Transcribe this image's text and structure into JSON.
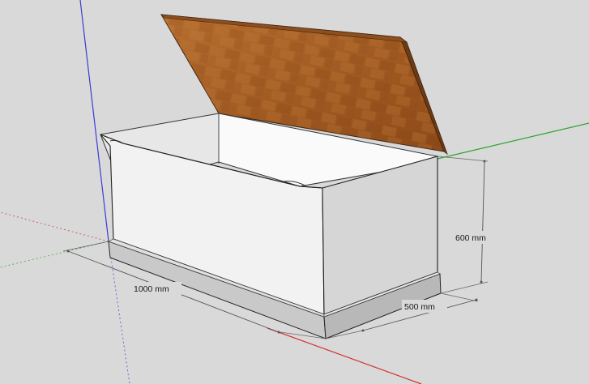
{
  "viewport": {
    "background": "#d9d9d9",
    "axes": {
      "red": "#d42f2f",
      "green": "#2fa52f",
      "blue": "#3b3bd6"
    }
  },
  "model": {
    "lid_color": "#a8622a",
    "body_color": "#f4f4f4",
    "base_color": "#d6d6d6"
  },
  "dimensions": {
    "height": "600 mm",
    "length": "1000 mm",
    "depth": "500 mm"
  }
}
